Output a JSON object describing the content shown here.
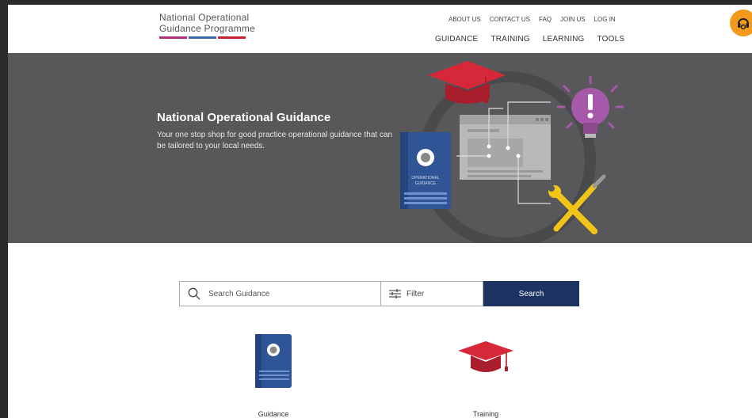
{
  "header": {
    "logo_line1": "National Operational",
    "logo_line2": "Guidance Programme",
    "logo_colors": [
      "#b0327c",
      "#3b6aa8",
      "#c8202f"
    ],
    "util_nav": [
      "ABOUT US",
      "CONTACT US",
      "FAQ",
      "JOIN US",
      "LOG IN"
    ],
    "main_nav": [
      "GUIDANCE",
      "TRAINING",
      "LEARNING",
      "TOOLS"
    ],
    "accessibility_icon": "headset-icon"
  },
  "hero": {
    "title": "National Operational Guidance",
    "subtitle": "Your one stop shop for good practice operational guidance that can be tailored to your local needs.",
    "book_line1": "OPERATIONAL",
    "book_line2": "GUIDANCE"
  },
  "search": {
    "placeholder": "Search Guidance",
    "value": "",
    "filter_label": "Filter",
    "button_label": "Search"
  },
  "categories": [
    {
      "label": "Guidance",
      "icon": "guidance-book-icon"
    },
    {
      "label": "Training",
      "icon": "graduation-cap-icon"
    }
  ],
  "colors": {
    "hero_bg": "#58585a",
    "search_button": "#1c3361",
    "accessibility": "#f39a1c",
    "cap_red": "#d7283a",
    "book_blue": "#2f5597"
  }
}
